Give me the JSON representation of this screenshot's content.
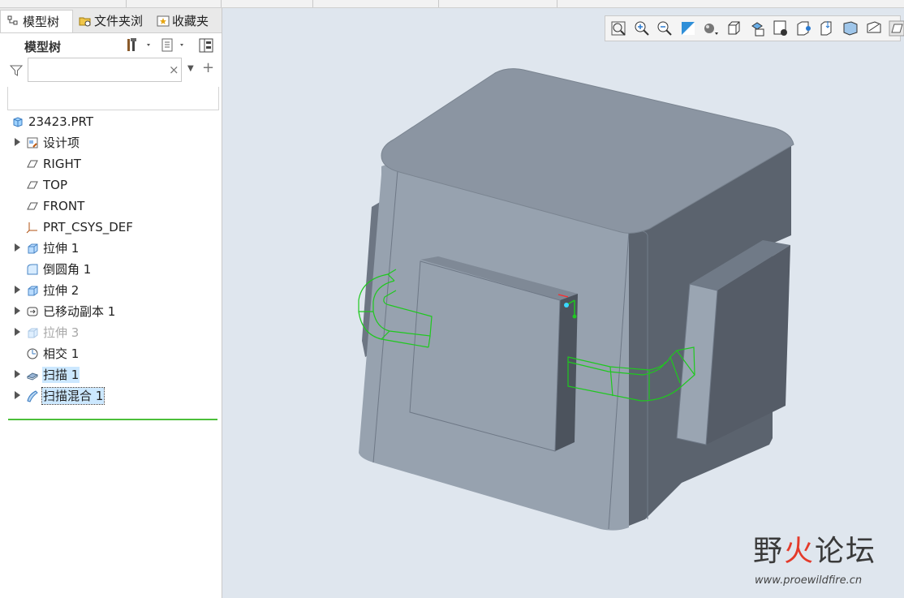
{
  "colors": {
    "viewport_bg": "#dfe6ee",
    "model_face_front": "#98a3b0",
    "model_face_top": "#8c96a3",
    "model_face_right": "#5a626d",
    "sweep_outline": "#1fc81f",
    "selection": "#cce8ff"
  },
  "tabs": [
    {
      "label": "模型树",
      "icon": "model-tree-icon",
      "active": true
    },
    {
      "label": "文件夹浏",
      "icon": "folder-browser-icon",
      "active": false
    },
    {
      "label": "收藏夹",
      "icon": "favorites-icon",
      "active": false
    }
  ],
  "panel": {
    "title": "模型树",
    "search": {
      "value": "",
      "placeholder": ""
    }
  },
  "tree": [
    {
      "label": "23423.PRT",
      "icon": "part-icon",
      "expandable": false,
      "indent": 0
    },
    {
      "label": "设计项",
      "icon": "design-items-icon",
      "expandable": true,
      "indent": 1
    },
    {
      "label": "RIGHT",
      "icon": "datum-plane-icon",
      "expandable": false,
      "indent": 1
    },
    {
      "label": "TOP",
      "icon": "datum-plane-icon",
      "expandable": false,
      "indent": 1
    },
    {
      "label": "FRONT",
      "icon": "datum-plane-icon",
      "expandable": false,
      "indent": 1
    },
    {
      "label": "PRT_CSYS_DEF",
      "icon": "coordinate-system-icon",
      "expandable": false,
      "indent": 1
    },
    {
      "label": "拉伸 1",
      "icon": "extrude-icon",
      "expandable": true,
      "indent": 1
    },
    {
      "label": "倒圆角 1",
      "icon": "round-icon",
      "expandable": false,
      "indent": 1
    },
    {
      "label": "拉伸 2",
      "icon": "extrude-icon",
      "expandable": true,
      "indent": 1
    },
    {
      "label": "已移动副本 1",
      "icon": "moved-copy-icon",
      "expandable": true,
      "indent": 1
    },
    {
      "label": "拉伸 3",
      "icon": "extrude-icon",
      "expandable": true,
      "indent": 1,
      "dim": true
    },
    {
      "label": "相交 1",
      "icon": "intersect-icon",
      "expandable": false,
      "indent": 1
    },
    {
      "label": "扫描 1",
      "icon": "sweep-icon",
      "expandable": true,
      "indent": 1,
      "selected": true
    },
    {
      "label": "扫描混合 1",
      "icon": "swept-blend-icon",
      "expandable": true,
      "indent": 1,
      "selected": true,
      "outlined": true
    }
  ],
  "view_toolbar": [
    "refit-icon",
    "zoom-in-icon",
    "zoom-out-icon",
    "repaint-icon",
    "display-style-icon",
    "saved-orientations-icon",
    "view-manager-icon",
    "perspective-icon",
    "datum-display-icon",
    "annotation-display-icon",
    "spin-center-icon",
    "appearance-icon",
    "section-icon"
  ],
  "watermark": {
    "title_part1": "野",
    "title_part2": "火",
    "title_part3": "论坛",
    "url": "www.proewildfire.cn"
  }
}
